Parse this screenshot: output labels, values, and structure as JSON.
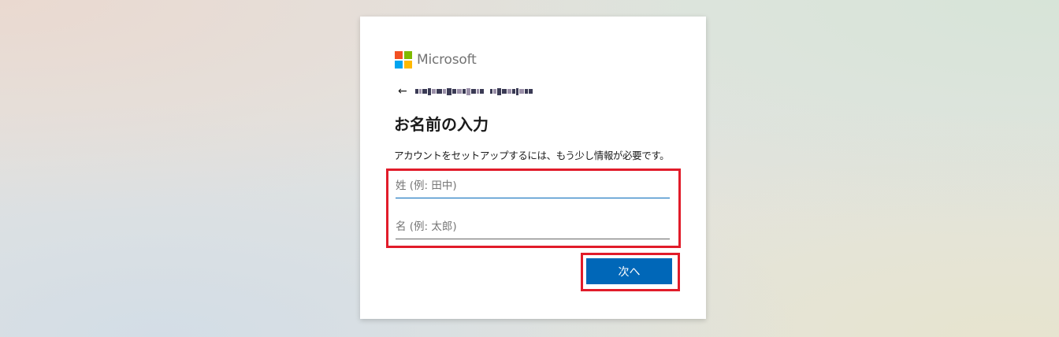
{
  "brand": {
    "name": "Microsoft",
    "logo_icon": "microsoft-logo-icon",
    "logo_colors": [
      "#f25022",
      "#7fba00",
      "#00a4ef",
      "#ffb900"
    ]
  },
  "identity": {
    "back_icon": "←",
    "email_masked": true
  },
  "page": {
    "title": "お名前の入力",
    "description": "アカウントをセットアップするには、もう少し情報が必要です。"
  },
  "form": {
    "last_name": {
      "placeholder": "姓 (例: 田中)",
      "value": ""
    },
    "first_name": {
      "placeholder": "名 (例: 太郎)",
      "value": ""
    }
  },
  "actions": {
    "next_label": "次へ"
  },
  "colors": {
    "accent": "#0067b8",
    "highlight": "#e11c2a"
  }
}
